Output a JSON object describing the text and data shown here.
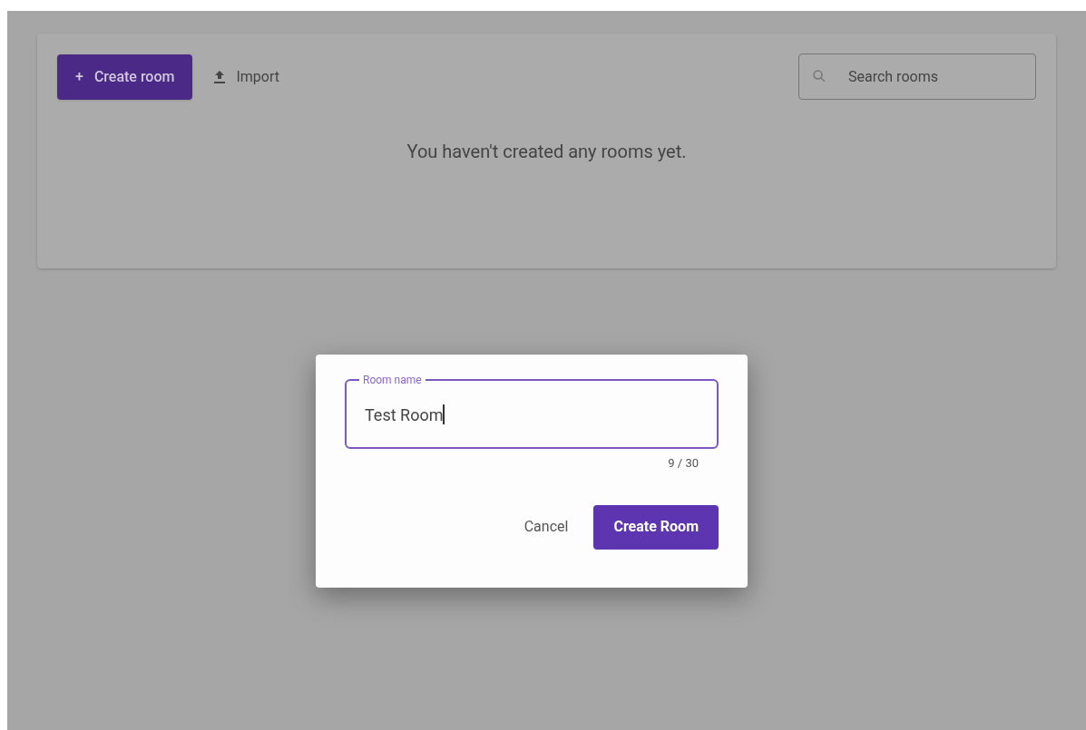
{
  "toolbar": {
    "create_button": {
      "icon": "+",
      "label": "Create room"
    },
    "import_button": {
      "label": "Import"
    },
    "search": {
      "placeholder": "Search rooms"
    }
  },
  "empty_message": "You haven't created any rooms yet.",
  "dialog": {
    "field": {
      "label": "Room name",
      "value": "Test Room",
      "counter": "9 / 30",
      "focused": true
    },
    "buttons": [
      {
        "label": "Cancel",
        "kind": "text"
      },
      {
        "label": "Create Room",
        "kind": "primary"
      }
    ]
  }
}
